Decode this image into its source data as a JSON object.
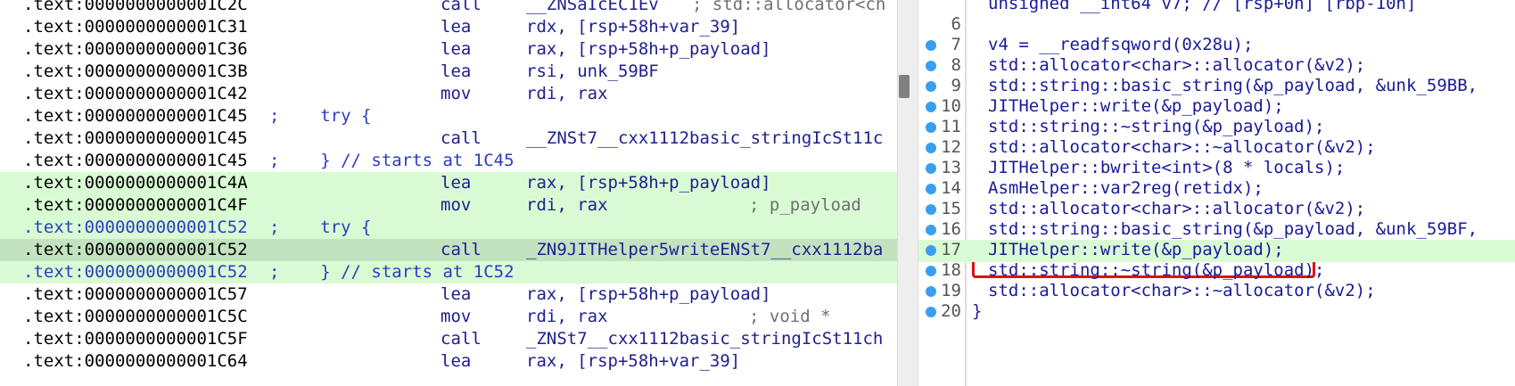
{
  "disassembly": {
    "rows": [
      {
        "addr": ".text:0000000000001C2C",
        "semi": "",
        "mn": "call",
        "op": "__ZNSaIcEC1Ev",
        "cmt": "; std::allocator<ch",
        "hl": "",
        "blue": false
      },
      {
        "addr": ".text:0000000000001C31",
        "semi": "",
        "mn": "lea",
        "op": "rdx, [rsp+58h+var_39]",
        "cmt": "",
        "hl": "",
        "blue": false
      },
      {
        "addr": ".text:0000000000001C36",
        "semi": "",
        "mn": "lea",
        "op": "rax, [rsp+58h+p_payload]",
        "cmt": "",
        "hl": "",
        "blue": false
      },
      {
        "addr": ".text:0000000000001C3B",
        "semi": "",
        "mn": "lea",
        "op": "rsi, unk_59BF",
        "cmt": "",
        "hl": "",
        "blue": false
      },
      {
        "addr": ".text:0000000000001C42",
        "semi": "",
        "mn": "mov",
        "op": "rdi, rax",
        "cmt": "",
        "hl": "",
        "blue": false
      },
      {
        "addr": ".text:0000000000001C45",
        "semi": ";    try {",
        "mn": "",
        "op": "",
        "cmt": "",
        "hl": "",
        "blue": false
      },
      {
        "addr": ".text:0000000000001C45",
        "semi": "",
        "mn": "call",
        "op": "__ZNSt7__cxx1112basic_stringIcSt11c",
        "cmt": "",
        "hl": "",
        "blue": false
      },
      {
        "addr": ".text:0000000000001C45",
        "semi": ";    } // starts at 1C45",
        "mn": "",
        "op": "",
        "cmt": "",
        "hl": "",
        "blue": false
      },
      {
        "addr": ".text:0000000000001C4A",
        "semi": "",
        "mn": "lea",
        "op": "rax, [rsp+58h+p_payload]",
        "cmt": "",
        "hl": "hl",
        "blue": false
      },
      {
        "addr": ".text:0000000000001C4F",
        "semi": "",
        "mn": "mov",
        "op": "rdi, rax",
        "cmt": "; p_payload",
        "hl": "hl",
        "blue": false
      },
      {
        "addr": ".text:0000000000001C52",
        "semi": ";    try {",
        "mn": "",
        "op": "",
        "cmt": "",
        "hl": "hl",
        "blue": true
      },
      {
        "addr": ".text:0000000000001C52",
        "semi": "",
        "mn": "call",
        "op": "_ZN9JITHelper5writeENSt7__cxx1112ba",
        "cmt": "",
        "hl": "cur",
        "blue": false
      },
      {
        "addr": ".text:0000000000001C52",
        "semi": ";    } // starts at 1C52",
        "mn": "",
        "op": "",
        "cmt": "",
        "hl": "hl",
        "blue": true
      },
      {
        "addr": ".text:0000000000001C57",
        "semi": "",
        "mn": "lea",
        "op": "rax, [rsp+58h+p_payload]",
        "cmt": "",
        "hl": "",
        "blue": false
      },
      {
        "addr": ".text:0000000000001C5C",
        "semi": "",
        "mn": "mov",
        "op": "rdi, rax",
        "cmt": "; void *",
        "hl": "",
        "blue": false
      },
      {
        "addr": ".text:0000000000001C5F",
        "semi": "",
        "mn": "call",
        "op": "_ZNSt7__cxx1112basic_stringIcSt11ch",
        "cmt": "",
        "hl": "",
        "blue": false
      },
      {
        "addr": ".text:0000000000001C64",
        "semi": "",
        "mn": "lea",
        "op": "rax, [rsp+58h+var_39]",
        "cmt": "",
        "hl": "",
        "blue": false
      }
    ]
  },
  "pseudocode": {
    "rows": [
      {
        "no": "",
        "dot": false,
        "code": "unsigned __int64 v7; // [rsp+0h] [rbp-10h]",
        "hl": false
      },
      {
        "no": "6",
        "dot": false,
        "code": "",
        "hl": false
      },
      {
        "no": "7",
        "dot": true,
        "code": "v4 = __readfsqword(0x28u);",
        "hl": false
      },
      {
        "no": "8",
        "dot": true,
        "code": "std::allocator<char>::allocator(&v2);",
        "hl": false
      },
      {
        "no": "9",
        "dot": true,
        "code": "std::string::basic_string(&p_payload, &unk_59BB,",
        "hl": false
      },
      {
        "no": "10",
        "dot": true,
        "code": "JITHelper::write(&p_payload);",
        "hl": false
      },
      {
        "no": "11",
        "dot": true,
        "code": "std::string::~string(&p_payload);",
        "hl": false
      },
      {
        "no": "12",
        "dot": true,
        "code": "std::allocator<char>::~allocator(&v2);",
        "hl": false
      },
      {
        "no": "13",
        "dot": true,
        "code": "JITHelper::bwrite<int>(8 * locals);",
        "hl": false
      },
      {
        "no": "14",
        "dot": true,
        "code": "AsmHelper::var2reg(retidx);",
        "hl": false
      },
      {
        "no": "15",
        "dot": true,
        "code": "std::allocator<char>::allocator(&v2);",
        "hl": false
      },
      {
        "no": "16",
        "dot": true,
        "code": "std::string::basic_string(&p_payload, &unk_59BF,",
        "hl": false
      },
      {
        "no": "17",
        "dot": true,
        "code": "JITHelper::write(&p_payload);",
        "hl": true
      },
      {
        "no": "18",
        "dot": true,
        "code": "std::string::~string(&p_payload);",
        "hl": false
      },
      {
        "no": "19",
        "dot": true,
        "code": "std::allocator<char>::~allocator(&v2);",
        "hl": false
      },
      {
        "no": "20",
        "dot": true,
        "code": "}",
        "hl": false
      }
    ]
  },
  "colors": {
    "highlight": "#d9fbd4",
    "current_line": "#c3e3c0",
    "callout_border": "#e01010",
    "breakpoint_dot": "#3a9ef0"
  }
}
